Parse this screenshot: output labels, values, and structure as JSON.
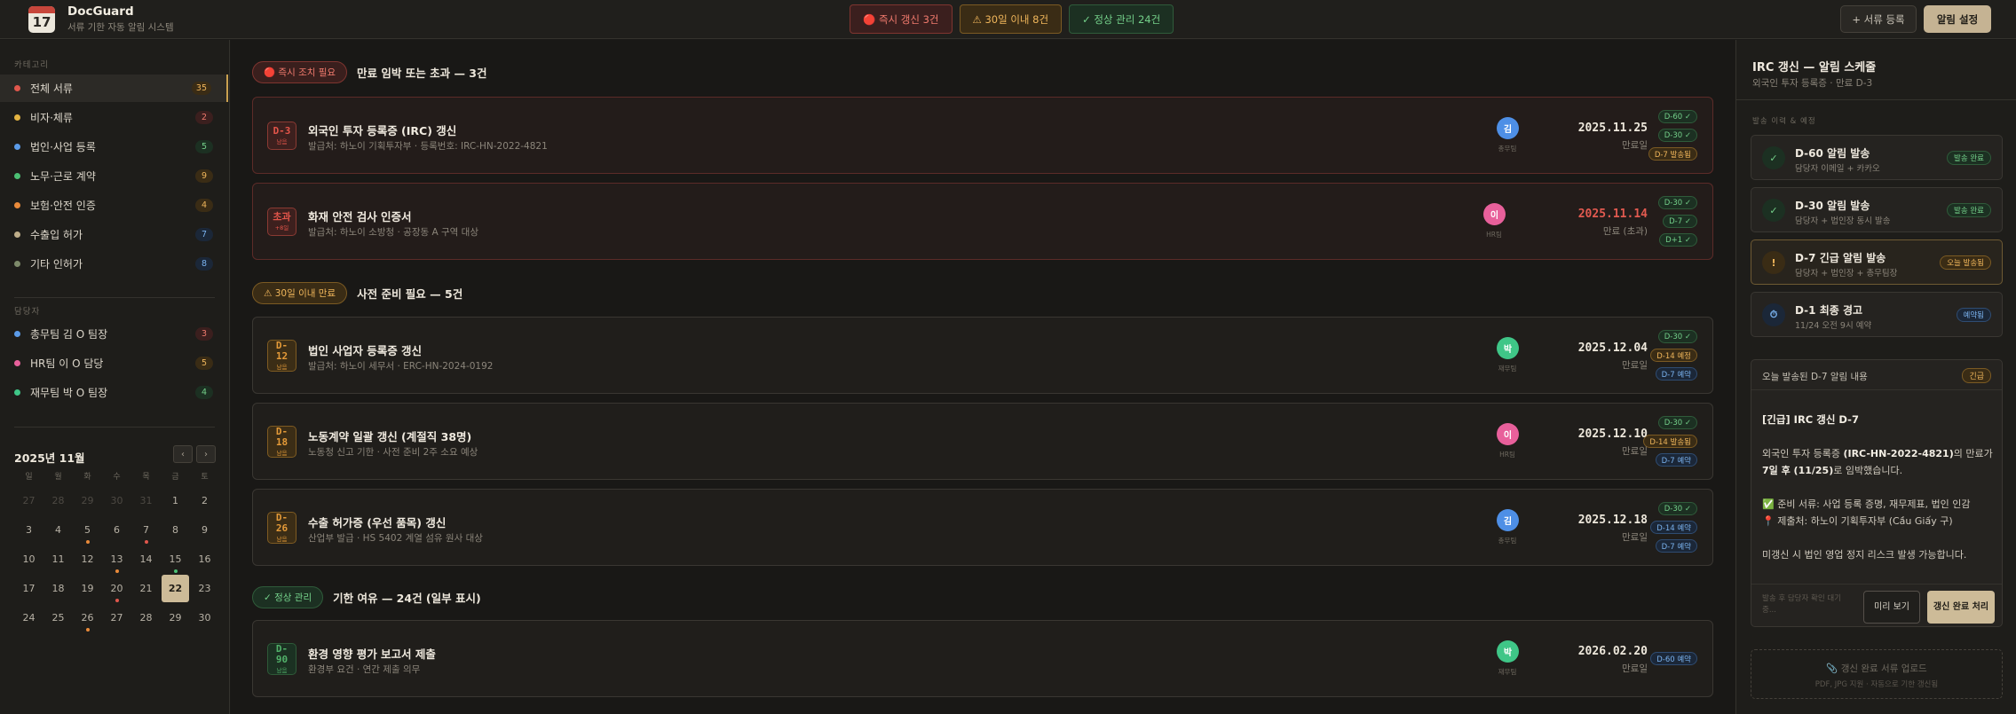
{
  "app": {
    "logo_day": "17",
    "name": "DocGuard",
    "subtitle": "서류 기한 자동 알림 시스템"
  },
  "summary": {
    "urgent": "🔴 즉시 갱신 3건",
    "warning": "⚠ 30일 이내 8건",
    "ok": "✓ 정상 관리 24건"
  },
  "header_actions": {
    "add": "+ 서류 등록",
    "settings": "알림 설정"
  },
  "sidebar": {
    "category_section": "카테고리",
    "categories": [
      {
        "label": "전체 서류",
        "count": "35",
        "color": "#e0574c",
        "count_bg": "#3a2c15",
        "count_fg": "#f0b65b"
      },
      {
        "label": "비자·체류",
        "count": "2",
        "color": "#e3b341",
        "count_bg": "#3b1f1e",
        "count_fg": "#f07a6d"
      },
      {
        "label": "법인·사업 등록",
        "count": "5",
        "color": "#5b9be8",
        "count_bg": "#1c3022",
        "count_fg": "#74d08a"
      },
      {
        "label": "노무·근로 계약",
        "count": "9",
        "color": "#4bbf73",
        "count_bg": "#3a2c15",
        "count_fg": "#f0b65b"
      },
      {
        "label": "보험·안전 인증",
        "count": "4",
        "color": "#e98a3a",
        "count_bg": "#3a2c15",
        "count_fg": "#f0b65b"
      },
      {
        "label": "수출입 허가",
        "count": "7",
        "color": "#bfae8a",
        "count_bg": "#1b2738",
        "count_fg": "#7ab2ee"
      },
      {
        "label": "기타 인허가",
        "count": "8",
        "color": "#7d8a6a",
        "count_bg": "#1b2738",
        "count_fg": "#7ab2ee"
      }
    ],
    "owner_section": "담당자",
    "owners": [
      {
        "label": "총무팀 김 O 팀장",
        "count": "3",
        "color": "#5b9be8",
        "count_bg": "#3b1f1e",
        "count_fg": "#f07a6d"
      },
      {
        "label": "HR팀 이 O 담당",
        "count": "5",
        "color": "#e8609b",
        "count_bg": "#3a2c15",
        "count_fg": "#f0b65b"
      },
      {
        "label": "재무팀 박 O 팀장",
        "count": "4",
        "color": "#3fc687",
        "count_bg": "#1c3022",
        "count_fg": "#74d08a"
      }
    ],
    "calendar": {
      "title": "2025년 11월",
      "prev": "‹",
      "next": "›",
      "weekdays": [
        "일",
        "월",
        "화",
        "수",
        "목",
        "금",
        "토"
      ],
      "days": [
        {
          "d": "27",
          "muted": true
        },
        {
          "d": "28",
          "muted": true
        },
        {
          "d": "29",
          "muted": true
        },
        {
          "d": "30",
          "muted": true
        },
        {
          "d": "31",
          "muted": true
        },
        {
          "d": "1"
        },
        {
          "d": "2"
        },
        {
          "d": "3"
        },
        {
          "d": "4"
        },
        {
          "d": "5",
          "mark": "#e98a3a"
        },
        {
          "d": "6"
        },
        {
          "d": "7",
          "mark": "#e0574c"
        },
        {
          "d": "8"
        },
        {
          "d": "9"
        },
        {
          "d": "10"
        },
        {
          "d": "11"
        },
        {
          "d": "12"
        },
        {
          "d": "13",
          "mark": "#e98a3a"
        },
        {
          "d": "14"
        },
        {
          "d": "15",
          "mark": "#4bbf73"
        },
        {
          "d": "16"
        },
        {
          "d": "17"
        },
        {
          "d": "18"
        },
        {
          "d": "19"
        },
        {
          "d": "20",
          "mark": "#e0574c"
        },
        {
          "d": "21"
        },
        {
          "d": "22",
          "today": true
        },
        {
          "d": "23"
        },
        {
          "d": "24"
        },
        {
          "d": "25"
        },
        {
          "d": "26",
          "mark": "#e98a3a"
        },
        {
          "d": "27"
        },
        {
          "d": "28"
        },
        {
          "d": "29"
        },
        {
          "d": "30"
        }
      ]
    }
  },
  "groups": {
    "urgent": {
      "tag": "🔴 즉시 조치 필요",
      "title": "만료 임박 또는 초과 — 3건"
    },
    "warning": {
      "tag": "⚠ 30일 이내 만료",
      "title": "사전 준비 필요 — 5건"
    },
    "ok": {
      "tag": "✓ 정상 관리",
      "title": "기한 여유 — 24건 (일부 표시)"
    }
  },
  "documents": [
    {
      "badge": "D-3",
      "badge_sub": "남음",
      "title": "외국인 투자 등록증 (IRC) 갱신",
      "sub": "발급처: 하노이 기획투자부 · 등록번호: IRC-HN-2022-4821",
      "avatar": "김",
      "avatar_color": "#4e8fe6",
      "avatar_sub": "총무팀",
      "date": "2025.11.25",
      "date_label": "만료일",
      "tags": [
        "D-60 ✓",
        "D-30 ✓",
        "D-7 발송됨"
      ]
    },
    {
      "badge": "초과",
      "badge_sub": "+8일",
      "title": "화재 안전 검사 인증서",
      "sub": "발급처: 하노이 소방청 · 공장동 A 구역 대상",
      "avatar": "이",
      "avatar_color": "#e8609b",
      "avatar_sub": "HR팀",
      "date": "2025.11.14",
      "date_label": "만료 (초과)",
      "tags": [
        "D-30 ✓",
        "D-7 ✓",
        "D+1 ✓"
      ]
    },
    {
      "badge": "D-12",
      "badge_sub": "남음",
      "title": "법인 사업자 등록증 갱신",
      "sub": "발급처: 하노이 세무서 · ERC-HN-2024-0192",
      "avatar": "박",
      "avatar_color": "#3fc687",
      "avatar_sub": "재무팀",
      "date": "2025.12.04",
      "date_label": "만료일",
      "tags": [
        "D-30 ✓",
        "D-14 예정",
        "D-7 예약"
      ]
    },
    {
      "badge": "D-18",
      "badge_sub": "남음",
      "title": "노동계약 일괄 갱신 (계절직 38명)",
      "sub": "노동청 신고 기한 · 사전 준비 2주 소요 예상",
      "avatar": "이",
      "avatar_color": "#e8609b",
      "avatar_sub": "HR팀",
      "date": "2025.12.10",
      "date_label": "만료일",
      "tags": [
        "D-30 ✓",
        "D-14 발송됨",
        "D-7 예약"
      ]
    },
    {
      "badge": "D-26",
      "badge_sub": "남음",
      "title": "수출 허가증 (우선 품목) 갱신",
      "sub": "산업부 발급 · HS 5402 계열 섬유 원사 대상",
      "avatar": "김",
      "avatar_color": "#4e8fe6",
      "avatar_sub": "총무팀",
      "date": "2025.12.18",
      "date_label": "만료일",
      "tags": [
        "D-30 ✓",
        "D-14 예약",
        "D-7 예약"
      ]
    },
    {
      "badge": "D-90",
      "badge_sub": "남음",
      "title": "환경 영향 평가 보고서 제출",
      "sub": "환경부 요건 · 연간 제출 의무",
      "avatar": "박",
      "avatar_color": "#3fc687",
      "avatar_sub": "재무팀",
      "date": "2026.02.20",
      "date_label": "만료일",
      "tags": [
        "D-60 예약"
      ]
    }
  ],
  "panel": {
    "title": "IRC 갱신 — 알림 스케줄",
    "subtitle": "외국인 투자 등록증 · 만료 D-3",
    "section": "발송 이력 & 예정",
    "steps": [
      {
        "icon": "✓",
        "title": "D-60 알림 발송",
        "sub": "담당자 이메일 + 카카오",
        "badge": "발송 완료"
      },
      {
        "icon": "✓",
        "title": "D-30 알림 발송",
        "sub": "담당자 + 법인장 동시 발송",
        "badge": "발송 완료"
      },
      {
        "icon": "!",
        "title": "D-7 긴급 알림 발송",
        "sub": "담당자 + 법인장 + 총무팀장",
        "badge": "오늘 발송됨"
      },
      {
        "icon": "⏱",
        "title": "D-1 최종 경고",
        "sub": "11/24 오전 9시 예약",
        "badge": "예약됨"
      }
    ],
    "message": {
      "head": "오늘 발송된 D-7 알림 내용",
      "badge": "긴급",
      "title": "[긴급] IRC 갱신 D-7",
      "p1_a": "외국인 투자 등록증 ",
      "p1_b": "(IRC-HN-2022-4821)",
      "p1_c": "의 만료가 ",
      "p1_d": "7일 후 (11/25)",
      "p1_e": "로 임박했습니다.",
      "docs": "✅ 준비 서류: 사업 등록 증명, 재무제표, 법인 인감",
      "place": "📍 제출처: 하노이 기획투자부 (Cầu Giấy 구)",
      "risk": "미갱신 시 법인 영업 정지 리스크 발생 가능합니다.",
      "hint": "발송 후 담당자 확인 대기 중...",
      "preview": "미리 보기",
      "done": "갱신 완료 처리"
    },
    "upload": {
      "title": "📎 갱신 완료 서류 업로드",
      "sub": "PDF, JPG 지원 · 자동으로 기한 갱신됨"
    }
  }
}
